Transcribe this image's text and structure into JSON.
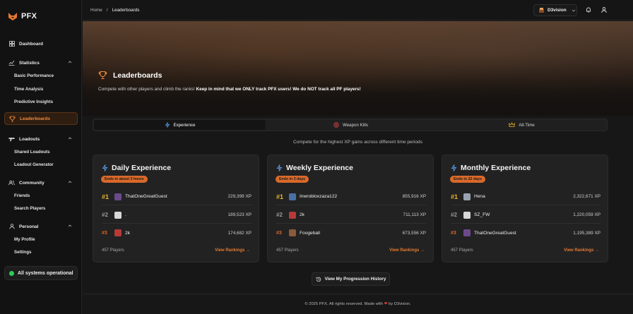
{
  "brand": {
    "name": "PFX",
    "accent": "#e8762f"
  },
  "sidebar": {
    "dashboard": "Dashboard",
    "statistics": {
      "label": "Statistics",
      "items": [
        "Basic Performance",
        "Time Analysis",
        "Predictive Insights"
      ]
    },
    "leaderboards": "Leaderboards",
    "loadouts": {
      "label": "Loadouts",
      "items": [
        "Shared Loadouts",
        "Loadout Generator"
      ]
    },
    "community": {
      "label": "Community",
      "items": [
        "Friends",
        "Search Players"
      ]
    },
    "personal": {
      "label": "Personal",
      "items": [
        "My Profile",
        "Settings"
      ]
    },
    "status": "All systems operational"
  },
  "topbar": {
    "breadcrumb": [
      "Home",
      "/",
      "Leaderboards"
    ],
    "username": "D3vision"
  },
  "hero": {
    "title": "Leaderboards",
    "desc_plain": "Compete with other players and climb the ranks! ",
    "desc_bold": "Keep in mind that we ONLY track PFX users! We do NOT track all PF players!"
  },
  "tabs": [
    "Experience",
    "Weapon Kills",
    "All-Time"
  ],
  "subtitle": "Compete for the highest XP gains across different time periods",
  "cards": [
    {
      "title": "Daily Experience",
      "ends": "Ends in about 3 hours",
      "rows": [
        {
          "rank": "#1",
          "name": "ThatOneGreatGuest",
          "xp": "229,399 XP"
        },
        {
          "rank": "#2",
          "name": ".",
          "xp": "189,523 XP"
        },
        {
          "rank": "#3",
          "name": "2k",
          "xp": "174,682 XP"
        }
      ],
      "players": "457 Players",
      "view": "View Rankings →"
    },
    {
      "title": "Weekly Experience",
      "ends": "Ends in 3 days",
      "rows": [
        {
          "rank": "#1",
          "name": "Inwrobloxzaza122",
          "xp": "855,916 XP"
        },
        {
          "rank": "#2",
          "name": "2k",
          "xp": "711,113 XP"
        },
        {
          "rank": "#3",
          "name": "Foogeball",
          "xp": "673,556 XP"
        }
      ],
      "players": "457 Players",
      "view": "View Rankings →"
    },
    {
      "title": "Monthly Experience",
      "ends": "Ends in 22 days",
      "rows": [
        {
          "rank": "#1",
          "name": "Hena",
          "xp": "2,322,671 XP"
        },
        {
          "rank": "#2",
          "name": "SZ_FW",
          "xp": "1,220,059 XP"
        },
        {
          "rank": "#3",
          "name": "ThatOneGreatGuest",
          "xp": "1,195,389 XP"
        }
      ],
      "players": "457 Players",
      "view": "View Rankings →"
    }
  ],
  "progress_button": "View My Progression History",
  "footer": {
    "left": "© 2025 PFX. All rights reserved. Made with",
    "right": "by D3vision."
  }
}
